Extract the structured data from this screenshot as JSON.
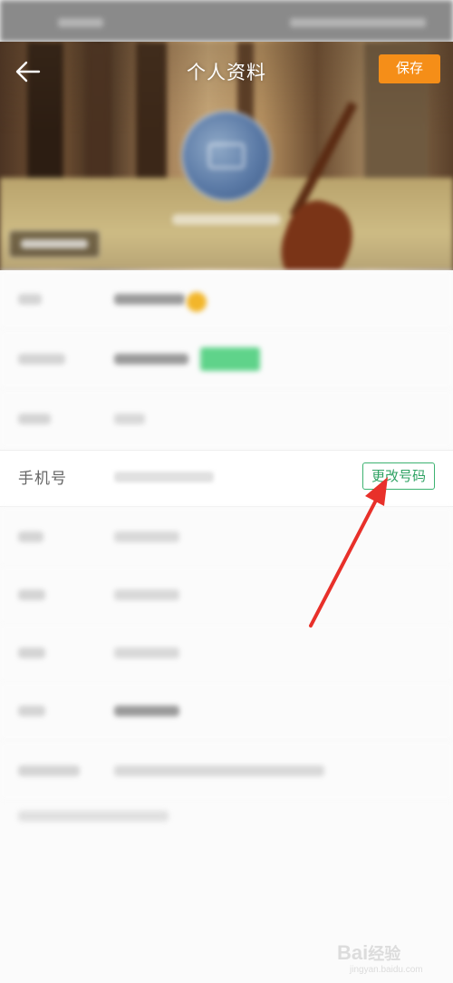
{
  "header": {
    "title": "个人资料",
    "save_label": "保存",
    "back_icon": "back-arrow-icon"
  },
  "profile": {
    "phone_label": "手机号",
    "change_number_label": "更改号码"
  },
  "colors": {
    "accent_orange": "#f58e18",
    "accent_green": "#3cb270",
    "annotation_red": "#e8302a"
  },
  "watermark": {
    "brand": "Bai",
    "brand2": "经验",
    "domain": "jingyan.baidu.com"
  }
}
